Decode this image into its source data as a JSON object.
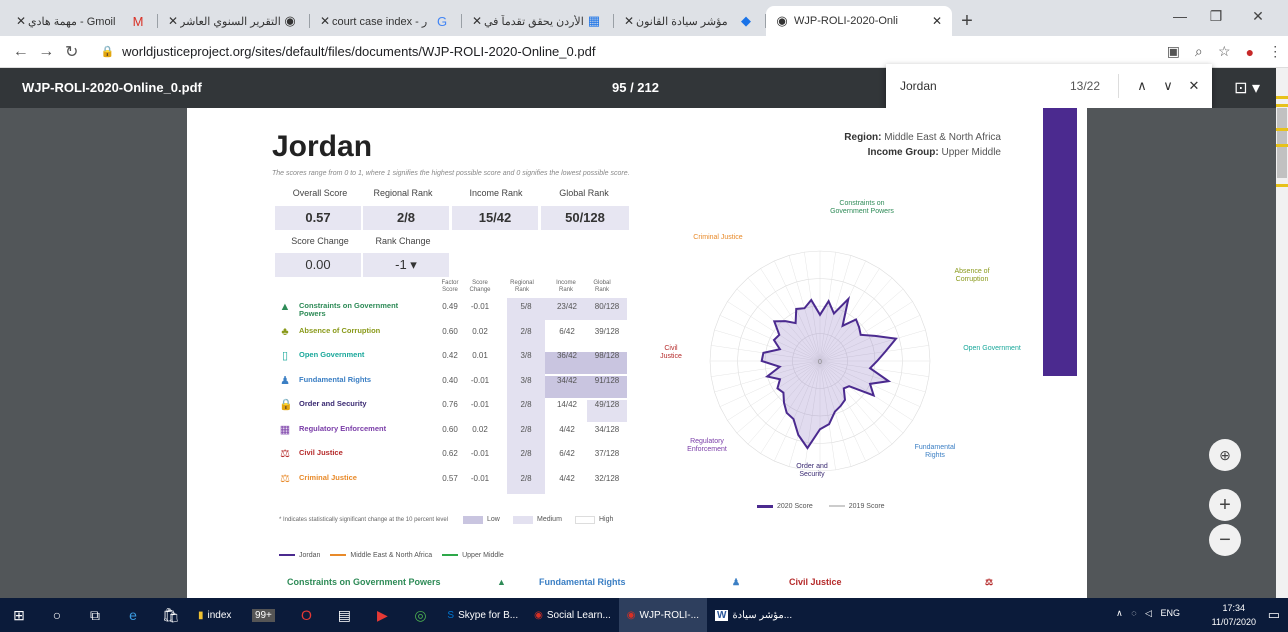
{
  "tabs": [
    {
      "label": "Gmoil - مهمة هادي",
      "icon": "M",
      "icon_color": "#d93025"
    },
    {
      "label": "التقرير السنوي العاشر",
      "icon": "◉",
      "icon_color": "#333"
    },
    {
      "label": "court case index - ر",
      "icon": "G",
      "icon_color": "#4285f4"
    },
    {
      "label": "الأردن يحقق تقدماً في",
      "icon": "▦",
      "icon_color": "#1a73e8"
    },
    {
      "label": "مؤشر سيادة القانون",
      "icon": "◆",
      "icon_color": "#1a73e8"
    },
    {
      "label": "WJP-ROLI-2020-Onli",
      "icon": "◉",
      "icon_color": "#333"
    }
  ],
  "browser": {
    "url": "worldjusticeproject.org/sites/default/files/documents/WJP-ROLI-2020-Online_0.pdf"
  },
  "pdf": {
    "title": "WJP-ROLI-2020-Online_0.pdf",
    "page": "95 / 212"
  },
  "find": {
    "query": "Jordan",
    "count": "13/22"
  },
  "report": {
    "country": "Jordan",
    "region_label": "Region:",
    "region": "Middle East & North Africa",
    "income_label": "Income Group:",
    "income": "Upper Middle",
    "scale_note": "The scores range from 0 to 1, where 1 signifies the highest possible score and 0 signifies the lowest possible score.",
    "overall_label": "Overall Score",
    "overall": "0.57",
    "regional_label": "Regional Rank",
    "regional": "2/8",
    "income_rank_label": "Income Rank",
    "income_rank": "15/42",
    "global_label": "Global Rank",
    "global": "50/128",
    "score_change_label": "Score Change",
    "score_change": "0.00",
    "rank_change_label": "Rank Change",
    "rank_change": "-1 ▾",
    "col_headers": [
      "Factor Score",
      "Score Change",
      "Regional Rank",
      "Income Rank",
      "Global Rank"
    ],
    "factors": [
      {
        "name": "Constraints on Government Powers",
        "color": "#2e8b57",
        "icon": "▲",
        "score": "0.49",
        "change": "-0.01",
        "reg": "5/8",
        "inc": "23/42",
        "glob": "80/128"
      },
      {
        "name": "Absence of Corruption",
        "color": "#8a9a1b",
        "icon": "♣",
        "score": "0.60",
        "change": "0.02",
        "reg": "2/8",
        "inc": "6/42",
        "glob": "39/128"
      },
      {
        "name": "Open Government",
        "color": "#1aa89b",
        "icon": "▯",
        "score": "0.42",
        "change": "0.01",
        "reg": "3/8",
        "inc": "36/42",
        "glob": "98/128"
      },
      {
        "name": "Fundamental Rights",
        "color": "#3b7fc4",
        "icon": "♟",
        "score": "0.40",
        "change": "-0.01",
        "reg": "3/8",
        "inc": "34/42",
        "glob": "91/128"
      },
      {
        "name": "Order and Security",
        "color": "#3a2a72",
        "icon": "🔒",
        "score": "0.76",
        "change": "-0.01",
        "reg": "2/8",
        "inc": "14/42",
        "glob": "49/128"
      },
      {
        "name": "Regulatory Enforcement",
        "color": "#7a3da8",
        "icon": "▦",
        "score": "0.60",
        "change": "0.02",
        "reg": "2/8",
        "inc": "4/42",
        "glob": "34/128"
      },
      {
        "name": "Civil Justice",
        "color": "#b52a2a",
        "icon": "⚖",
        "score": "0.62",
        "change": "-0.01",
        "reg": "2/8",
        "inc": "6/42",
        "glob": "37/128"
      },
      {
        "name": "Criminal Justice",
        "color": "#e88a2a",
        "icon": "⚖",
        "score": "0.57",
        "change": "-0.01",
        "reg": "2/8",
        "inc": "4/42",
        "glob": "32/128"
      }
    ],
    "sig_note": "* Indicates statistically significant change at the 10 percent level",
    "legend_low": "Low",
    "legend_medium": "Medium",
    "legend_high": "High",
    "line_legend": [
      {
        "label": "Jordan",
        "color": "#4b2a8f"
      },
      {
        "label": "Middle East & North Africa",
        "color": "#e88a2a"
      },
      {
        "label": "Upper Middle",
        "color": "#2ea84a"
      }
    ],
    "sections": [
      "Constraints on Government Powers",
      "Fundamental Rights",
      "Civil Justice"
    ],
    "radar_labels": {
      "constraints": "Constraints on Government Powers",
      "corruption": "Absence of Corruption",
      "open": "Open Government",
      "rights": "Fundamental Rights",
      "order": "Order and Security",
      "regulatory": "Regulatory Enforcement",
      "civil": "Civil Justice",
      "criminal": "Criminal Justice"
    },
    "radar_legend_2020": "2020 Score",
    "radar_legend_2019": "2019 Score",
    "radar_center": "0"
  },
  "chart_data": {
    "type": "radar",
    "title": "",
    "range": [
      0,
      1
    ],
    "series": [
      {
        "name": "2020 Score",
        "color": "#4b2a8f",
        "values": [
          0.42,
          0.55,
          0.45,
          0.62,
          0.38,
          0.5,
          0.47,
          0.44,
          0.55,
          0.72,
          0.6,
          0.52,
          0.46,
          0.65,
          0.5,
          0.58,
          0.35,
          0.33,
          0.42,
          0.45,
          0.48,
          0.58,
          0.62,
          0.8,
          0.7,
          0.58,
          0.56,
          0.5,
          0.44,
          0.46,
          0.4,
          0.5,
          0.37,
          0.53,
          0.52,
          0.38,
          0.46,
          0.44,
          0.55,
          0.48,
          0.41,
          0.52,
          0.5,
          0.56
        ]
      }
    ]
  },
  "taskbar": {
    "apps": [
      {
        "label": "index",
        "icon": "▮",
        "color": "#f1c232"
      },
      {
        "label": "Skype for B...",
        "icon": "S",
        "color": "#0078d4"
      },
      {
        "label": "Social Learn...",
        "icon": "◉",
        "color": "#d93025"
      },
      {
        "label": "WJP-ROLI-...",
        "icon": "◉",
        "color": "#d93025"
      },
      {
        "label": "مؤشر سيادة...",
        "icon": "W",
        "color": "#2b579a"
      }
    ],
    "badge": "99+",
    "lang": "ENG",
    "time": "17:34",
    "date": "11/07/2020"
  }
}
